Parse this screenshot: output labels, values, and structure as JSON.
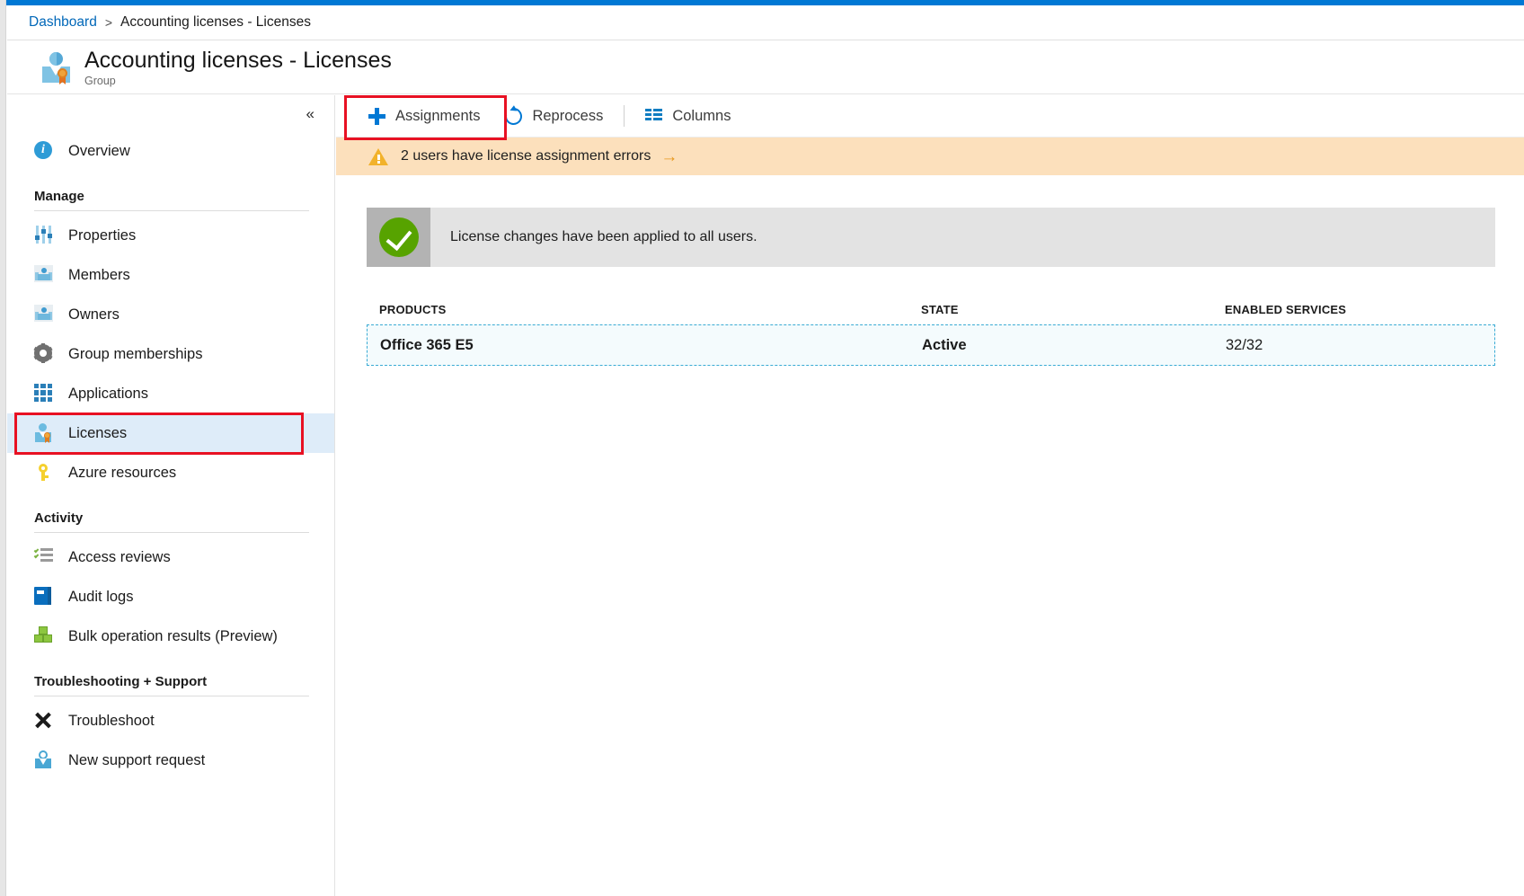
{
  "breadcrumb": {
    "root": "Dashboard",
    "separator": ">",
    "current": "Accounting licenses - Licenses"
  },
  "header": {
    "title": "Accounting licenses - Licenses",
    "subtitle": "Group",
    "icon": "group-badge-icon"
  },
  "sidebar": {
    "collapse_label": "«",
    "top_items": [
      {
        "label": "Overview",
        "icon": "info-icon"
      }
    ],
    "sections": [
      {
        "title": "Manage",
        "items": [
          {
            "label": "Properties",
            "icon": "sliders-icon"
          },
          {
            "label": "Members",
            "icon": "people-icon"
          },
          {
            "label": "Owners",
            "icon": "people-icon"
          },
          {
            "label": "Group memberships",
            "icon": "gear-icon"
          },
          {
            "label": "Applications",
            "icon": "grid-apps-icon"
          },
          {
            "label": "Licenses",
            "icon": "license-badge-icon",
            "selected": true
          },
          {
            "label": "Azure resources",
            "icon": "key-icon"
          }
        ]
      },
      {
        "title": "Activity",
        "items": [
          {
            "label": "Access reviews",
            "icon": "checklist-icon"
          },
          {
            "label": "Audit logs",
            "icon": "book-icon"
          },
          {
            "label": "Bulk operation results (Preview)",
            "icon": "boxes-icon"
          }
        ]
      },
      {
        "title": "Troubleshooting + Support",
        "items": [
          {
            "label": "Troubleshoot",
            "icon": "wrench-screwdriver-icon"
          },
          {
            "label": "New support request",
            "icon": "support-person-icon"
          }
        ]
      }
    ]
  },
  "toolbar": {
    "assignments_label": "Assignments",
    "assignments_icon": "plus-icon",
    "reprocess_label": "Reprocess",
    "reprocess_icon": "refresh-icon",
    "columns_label": "Columns",
    "columns_icon": "columns-icon"
  },
  "warning_banner": {
    "icon": "warning-triangle-icon",
    "text": "2 users have license assignment errors",
    "arrow": "→",
    "background_color": "#fce0bc",
    "icon_color": "#f2b22b"
  },
  "success_panel": {
    "icon": "green-check-icon",
    "text": "License changes have been applied to all users.",
    "icon_color": "#57a300",
    "background_color": "#e3e3e3"
  },
  "table": {
    "columns": [
      "PRODUCTS",
      "STATE",
      "ENABLED SERVICES"
    ],
    "rows": [
      {
        "product": "Office 365 E5",
        "state": "Active",
        "enabled_services": "32/32"
      }
    ]
  },
  "highlights": {
    "color": "#e81123",
    "targets": [
      "assignments-toolbar-button",
      "sidebar-item-licenses"
    ]
  }
}
